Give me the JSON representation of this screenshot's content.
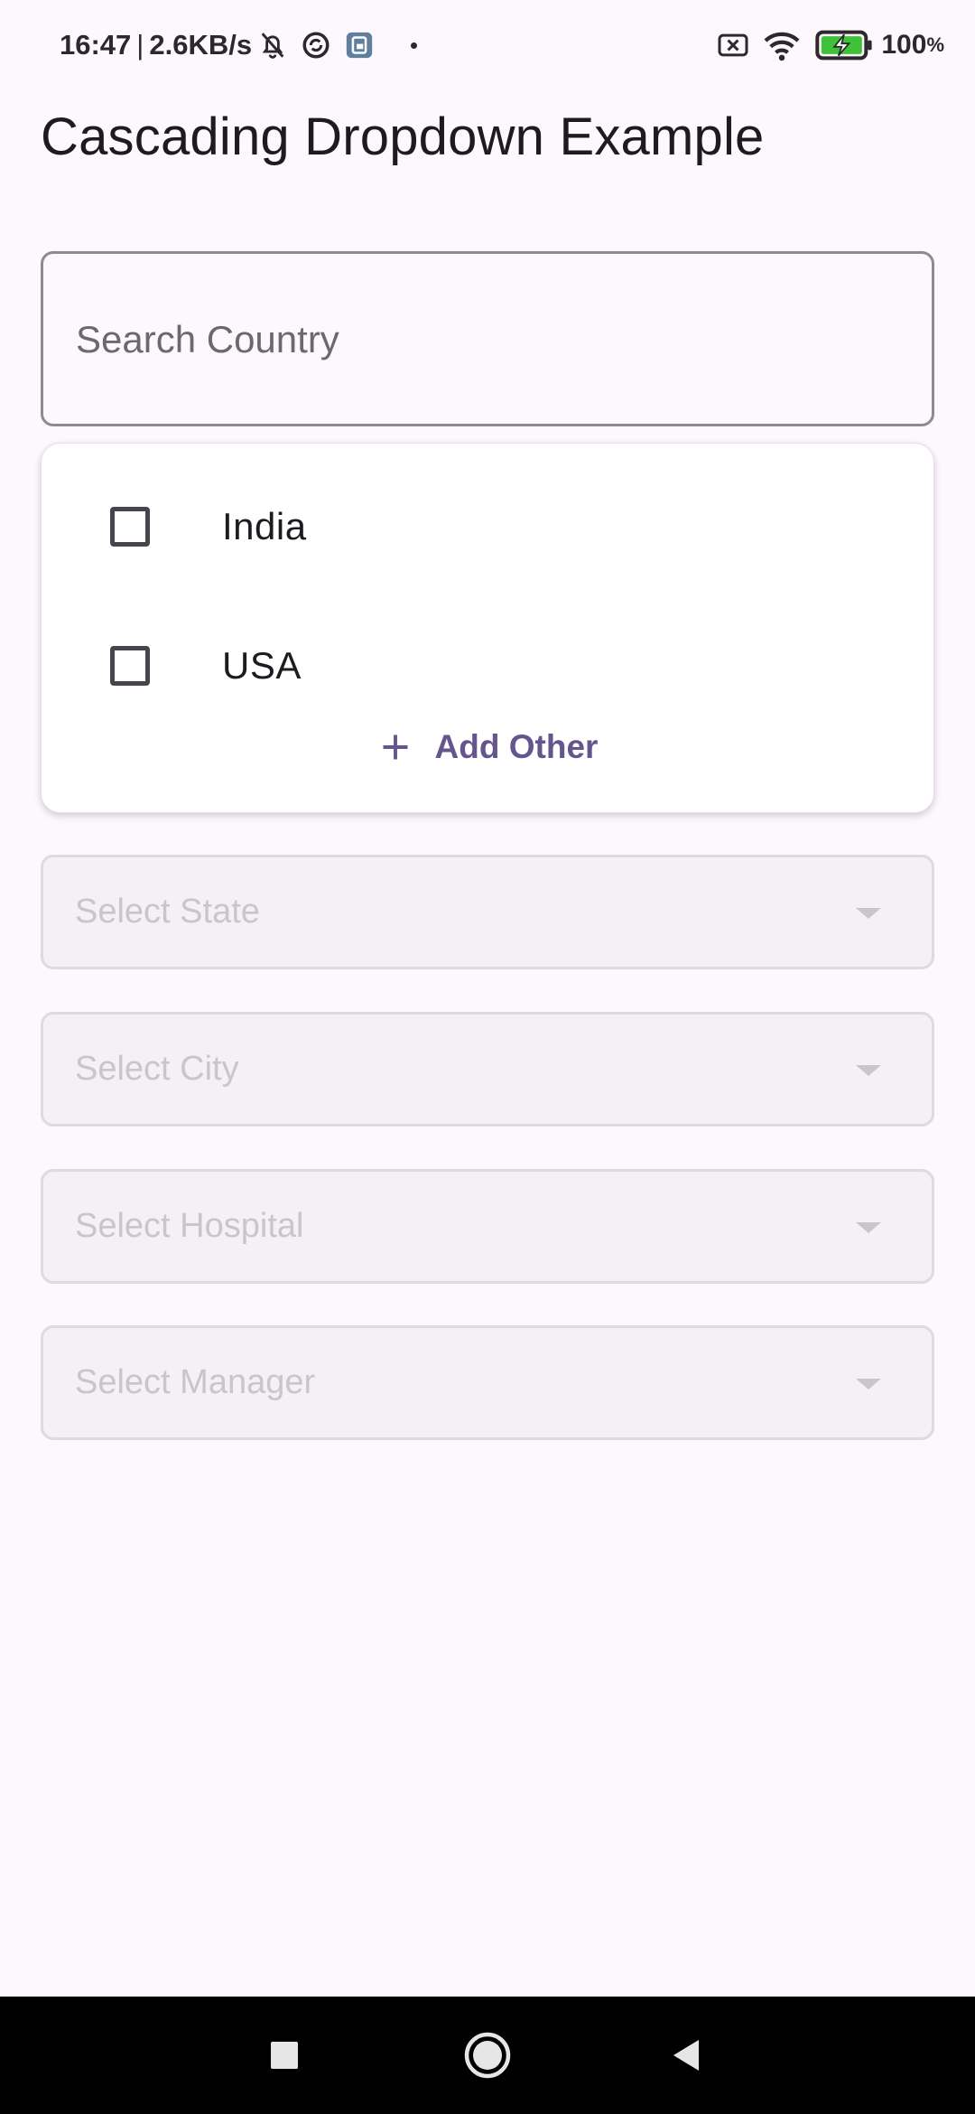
{
  "status_bar": {
    "time": "16:47",
    "separator": "|",
    "speed": "2.6KB/s",
    "battery_value": "100",
    "battery_unit": "%",
    "icons": [
      "bell-muted-icon",
      "sync-icon",
      "app-notification-icon",
      "dot-icon",
      "sim-blocked-icon",
      "wifi-icon",
      "battery-charging-icon"
    ]
  },
  "app": {
    "title": "Cascading Dropdown Example"
  },
  "search": {
    "placeholder": "Search Country",
    "value": ""
  },
  "dropdown": {
    "options": [
      {
        "label": "India",
        "checked": false
      },
      {
        "label": "USA",
        "checked": false
      }
    ],
    "add_other_label": "Add Other"
  },
  "selects": [
    {
      "label": "Select State",
      "enabled": false
    },
    {
      "label": "Select City",
      "enabled": false
    },
    {
      "label": "Select Hospital",
      "enabled": false
    },
    {
      "label": "Select Manager",
      "enabled": false
    }
  ],
  "nav_bar": {
    "buttons": [
      "recents-icon",
      "home-icon",
      "back-icon"
    ]
  },
  "colors": {
    "background": "#fdf7fe",
    "accent": "#65558f",
    "disabled_text": "#c9c5cb",
    "battery_green": "#3fc23a"
  }
}
